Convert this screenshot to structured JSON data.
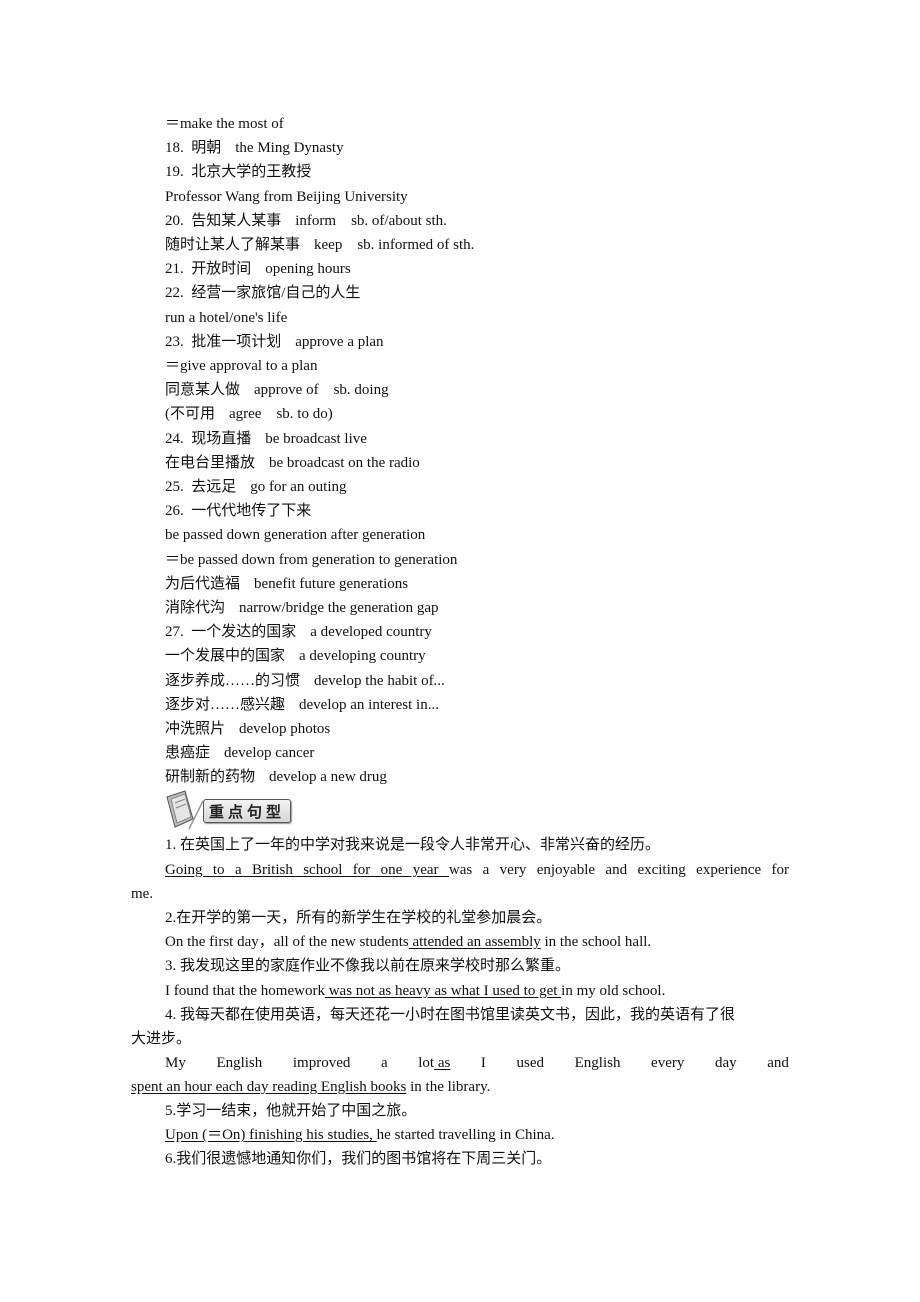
{
  "vocab_lines": [
    {
      "zh": "",
      "en": "＝make the most of"
    },
    {
      "zh": "18.  明朝",
      "en": "the Ming Dynasty"
    },
    {
      "zh": "19.  北京大学的王教授",
      "en": ""
    },
    {
      "zh": "",
      "en": "Professor Wang from Beijing University"
    },
    {
      "zh": "20.  告知某人某事",
      "en": "inform    sb. of/about sth."
    },
    {
      "zh": "随时让某人了解某事",
      "en": "keep    sb. informed of sth."
    },
    {
      "zh": "21.  开放时间",
      "en": "opening hours"
    },
    {
      "zh": "22.  经营一家旅馆/自己的人生",
      "en": ""
    },
    {
      "zh": "",
      "en": "run a hotel/one's life"
    },
    {
      "zh": "23.  批准一项计划",
      "en": "approve a plan"
    },
    {
      "zh": "",
      "en": "＝give approval to a plan"
    },
    {
      "zh": "同意某人做",
      "en": "approve of    sb. doing"
    },
    {
      "zh": "(不可用",
      "en": "agree    sb. to do)"
    },
    {
      "zh": "24.  现场直播",
      "en": "be broadcast live"
    },
    {
      "zh": "在电台里播放",
      "en": "be broadcast on the radio"
    },
    {
      "zh": "25.  去远足",
      "en": "go for an outing"
    },
    {
      "zh": "26.  一代代地传了下来",
      "en": ""
    },
    {
      "zh": "",
      "en": "be passed down generation after generation"
    },
    {
      "zh": "",
      "en": "＝be passed down from generation to generation"
    },
    {
      "zh": "为后代造福",
      "en": "benefit future generations"
    },
    {
      "zh": "消除代沟",
      "en": "narrow/bridge the generation gap"
    },
    {
      "zh": "27.  一个发达的国家",
      "en": "a developed country"
    },
    {
      "zh": "一个发展中的国家",
      "en": "a developing country"
    },
    {
      "zh": "逐步养成……的习惯",
      "en": "develop the habit of..."
    },
    {
      "zh": "逐步对……感兴趣",
      "en": "develop an interest in..."
    },
    {
      "zh": "冲洗照片",
      "en": "develop photos"
    },
    {
      "zh": "患癌症",
      "en": "develop cancer"
    },
    {
      "zh": "研制新的药物",
      "en": "develop a new drug"
    }
  ],
  "section_title": "重点句型",
  "sentences": {
    "s1_zh": "1.  在英国上了一年的中学对我来说是一段令人非常开心、非常兴奋的经历。",
    "s1_u": " Going  to  a  British  school  for  one  year ",
    "s1_rest": "was  a  very  enjoyable  and  exciting  experience  for",
    "s1_cont": "me.",
    "s2_zh": "2.在开学的第一天，所有的新学生在学校的礼堂参加晨会。",
    "s2_pre": "On the first day，all of the new students",
    "s2_u": " attended  an  assembly",
    "s2_post": " in the school hall.",
    "s3_zh": "3.  我发现这里的家庭作业不像我以前在原来学校时那么繁重。",
    "s3_pre": "I found that the homework",
    "s3_u": " was  not  as  heavy  as  what  I  used  to  get ",
    "s3_post": "in my old school.",
    "s4_zh": "4.  我每天都在使用英语，每天还花一小时在图书馆里读英文书，因此，我的英语有了很",
    "s4_zh_cont": "大进步。",
    "s4_words": [
      "My",
      "English",
      "improved",
      "a",
      "lot",
      "I",
      "used",
      "English",
      "every",
      "day",
      "and"
    ],
    "s4_u1": " as",
    "s4_u2": "spent  an  hour  each  day  reading  English  books",
    "s4_post": " in the library.",
    "s5_zh": "5.学习一结束，他就开始了中国之旅。",
    "s5_u": "Upon  (＝On)  finishing  his  studies, ",
    "s5_post": "he started travelling in China.",
    "s6_zh": "6.我们很遗憾地通知你们，我们的图书馆将在下周三关门。"
  }
}
